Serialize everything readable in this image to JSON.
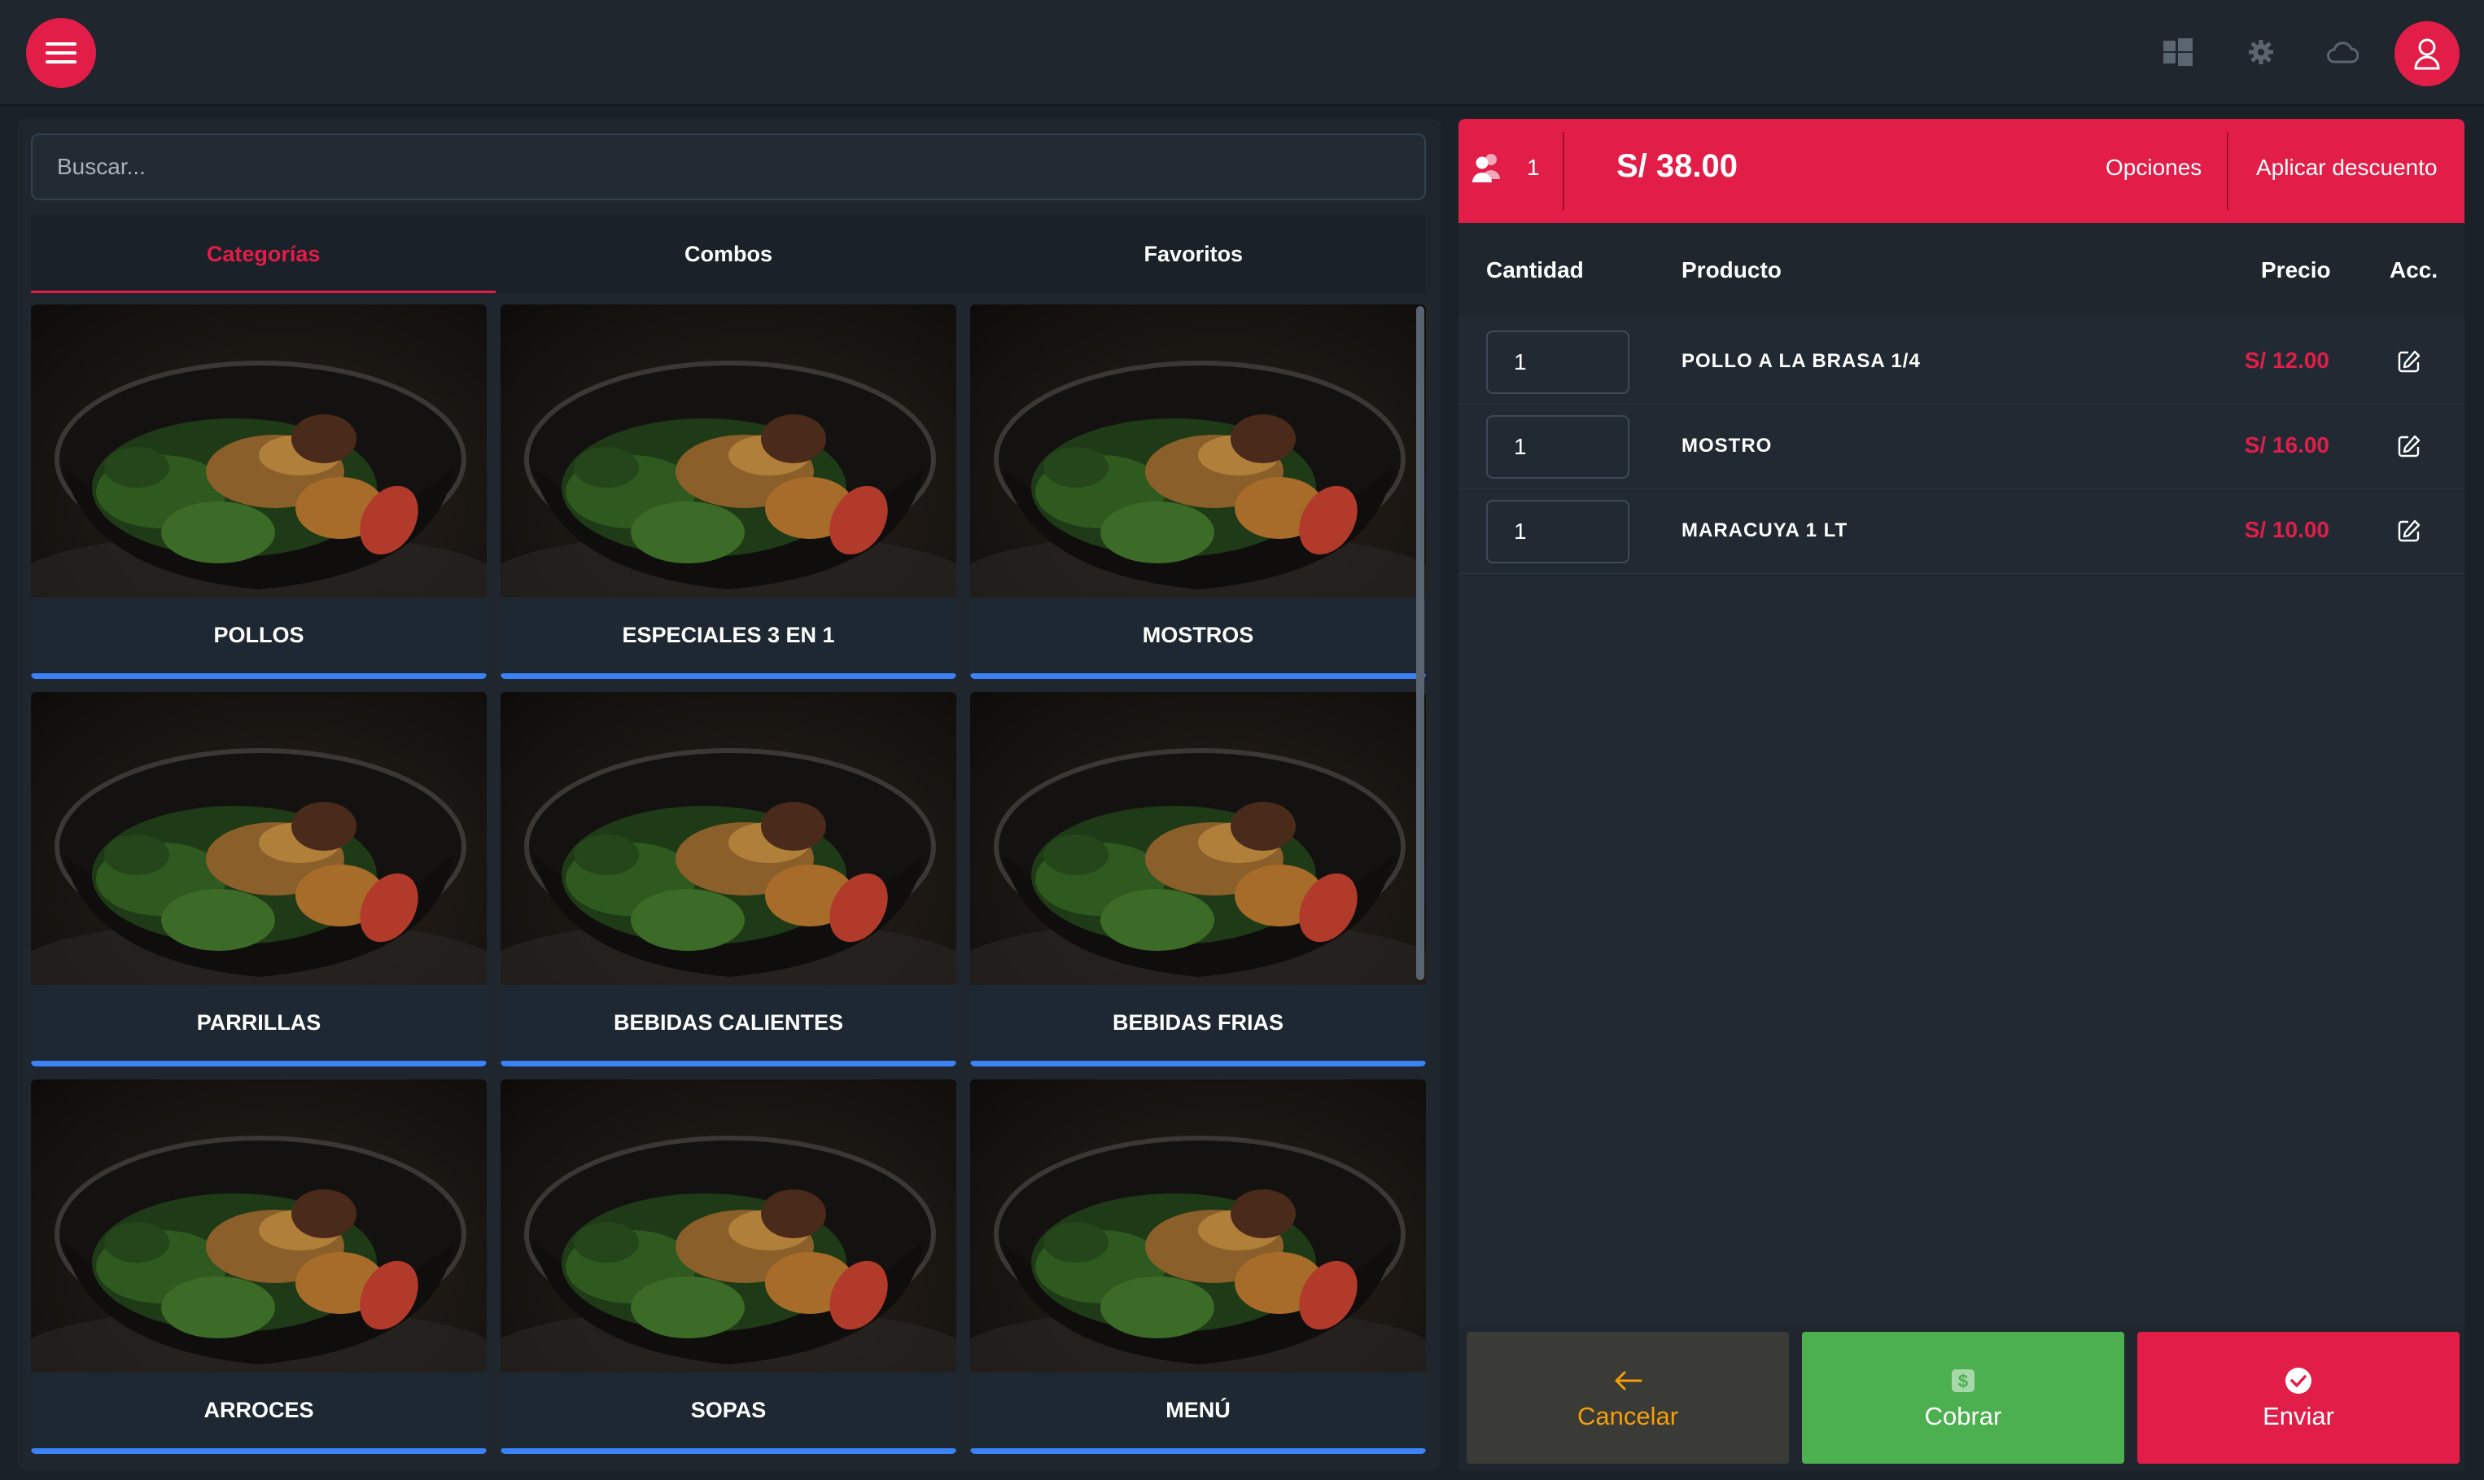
{
  "topbar": {
    "menu_icon": "hamburger-menu-icon",
    "icons": [
      "windows-icon",
      "gear-icon",
      "cloud-icon",
      "user-icon"
    ],
    "accent_color": "#e11d48"
  },
  "search": {
    "placeholder": "Buscar...",
    "value": ""
  },
  "tabs": [
    {
      "label": "Categorías",
      "active": true
    },
    {
      "label": "Combos",
      "active": false
    },
    {
      "label": "Favoritos",
      "active": false
    }
  ],
  "categories": [
    {
      "label": "POLLOS"
    },
    {
      "label": "ESPECIALES 3 EN 1"
    },
    {
      "label": "MOSTROS"
    },
    {
      "label": "PARRILLAS"
    },
    {
      "label": "BEBIDAS CALIENTES"
    },
    {
      "label": "BEBIDAS FRIAS"
    },
    {
      "label": "ARROCES"
    },
    {
      "label": "SOPAS"
    },
    {
      "label": "MENÚ"
    }
  ],
  "order": {
    "guests": "1",
    "total": "S/ 38.00",
    "options_label": "Opciones",
    "discount_label": "Aplicar descuento",
    "columns": {
      "qty": "Cantidad",
      "product": "Producto",
      "price": "Precio",
      "actions": "Acc."
    },
    "items": [
      {
        "qty": "1",
        "product": "POLLO A LA BRASA 1/4",
        "price": "S/ 12.00"
      },
      {
        "qty": "1",
        "product": "MOSTRO",
        "price": "S/ 16.00"
      },
      {
        "qty": "1",
        "product": "MARACUYA 1 LT",
        "price": "S/ 10.00"
      }
    ]
  },
  "actions": {
    "cancel": "Cancelar",
    "cobrar": "Cobrar",
    "enviar": "Enviar",
    "cancel_color": "#f59e0b",
    "cobrar_color": "#4caf50",
    "enviar_color": "#e11d48"
  }
}
